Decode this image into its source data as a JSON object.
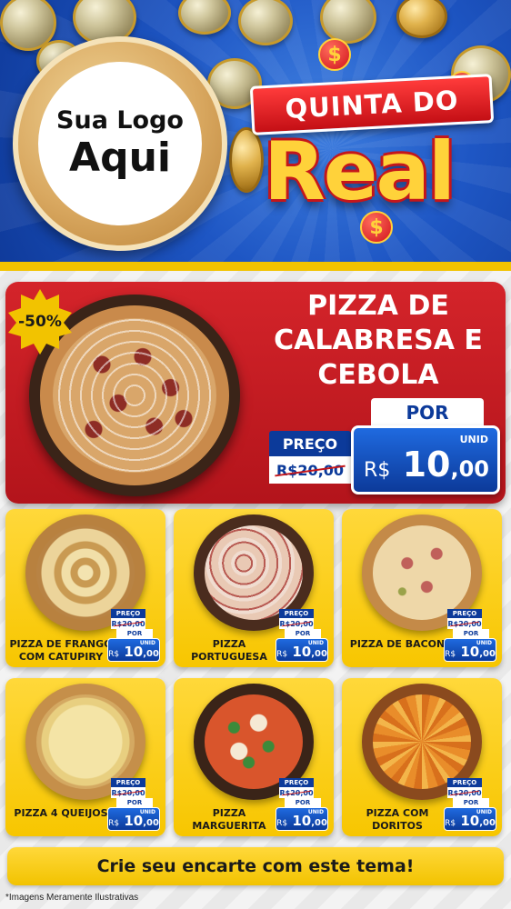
{
  "logo": {
    "line1": "Sua Logo",
    "line2": "Aqui"
  },
  "promo": {
    "line1": "QUINTA DO",
    "word": "Real",
    "currency_symbol": "$"
  },
  "colors": {
    "header_blue": "#1e56c4",
    "hero_red": "#c4161b",
    "card_yellow": "#f7c600",
    "price_blue": "#0c3a9a",
    "accent_gold": "#ffd23a"
  },
  "hero": {
    "discount": "-50%",
    "title": "PIZZA DE CALABRESA E CEBOLA",
    "por": "POR",
    "preco_label": "PREÇO",
    "old_price": "R$20,00",
    "unid": "UNID",
    "currency": "R$",
    "price_int": "10",
    "price_cents": ",00"
  },
  "products": [
    {
      "name": "PIZZA DE FRANGO COM CATUPIRY",
      "preco_label": "PREÇO",
      "old_price": "R$20,00",
      "por": "POR",
      "unid": "UNID",
      "currency": "R$",
      "price_int": "10",
      "price_cents": ",00"
    },
    {
      "name": "PIZZA PORTUGUESA",
      "preco_label": "PREÇO",
      "old_price": "R$20,00",
      "por": "POR",
      "unid": "UNID",
      "currency": "R$",
      "price_int": "10",
      "price_cents": ",00"
    },
    {
      "name": "PIZZA DE BACON",
      "preco_label": "PREÇO",
      "old_price": "R$20,00",
      "por": "POR",
      "unid": "UNID",
      "currency": "R$",
      "price_int": "10",
      "price_cents": ",00"
    },
    {
      "name": "PIZZA 4 QUEIJOS",
      "preco_label": "PREÇO",
      "old_price": "R$20,00",
      "por": "POR",
      "unid": "UNID",
      "currency": "R$",
      "price_int": "10",
      "price_cents": ",00"
    },
    {
      "name": "PIZZA MARGUERITA",
      "preco_label": "PREÇO",
      "old_price": "R$20,00",
      "por": "POR",
      "unid": "UNID",
      "currency": "R$",
      "price_int": "10",
      "price_cents": ",00"
    },
    {
      "name": "PIZZA COM DORITOS",
      "preco_label": "PREÇO",
      "old_price": "R$20,00",
      "por": "POR",
      "unid": "UNID",
      "currency": "R$",
      "price_int": "10",
      "price_cents": ",00"
    }
  ],
  "footer": {
    "cta": "Crie seu encarte com este tema!",
    "disclaimer": "*Imagens Meramente Ilustrativas"
  }
}
